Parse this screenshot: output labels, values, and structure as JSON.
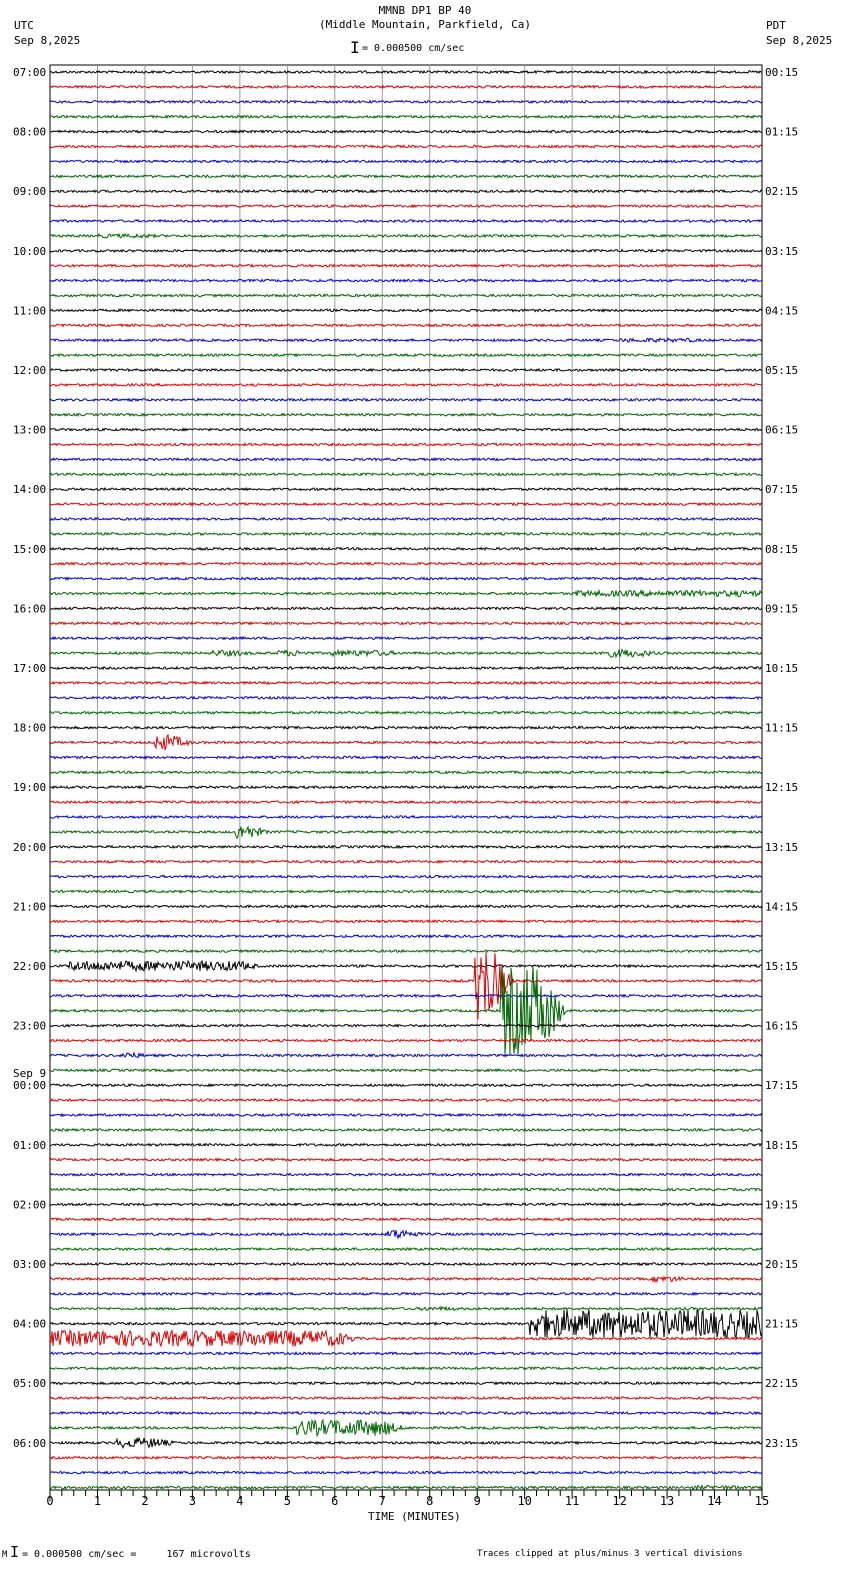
{
  "header": {
    "title": "MMNB DP1 BP 40",
    "subtitle": "(Middle Mountain, Parkfield, Ca)",
    "left_tz": "UTC",
    "left_date": "Sep 8,2025",
    "right_tz": "PDT",
    "right_date": "Sep 8,2025",
    "scale": "= 0.000500 cm/sec"
  },
  "footer": {
    "scale": "= 0.000500 cm/sec =     167 microvolts",
    "clip_note": "Traces clipped at plus/minus 3 vertical divisions",
    "mark": "M"
  },
  "chart_data": {
    "type": "line",
    "title": "MMNB DP1 BP 40",
    "xlabel": "TIME (MINUTES)",
    "xlim": [
      0,
      15
    ],
    "x_ticks": [
      "0",
      "1",
      "2",
      "3",
      "4",
      "5",
      "6",
      "7",
      "8",
      "9",
      "10",
      "11",
      "12",
      "13",
      "14",
      "15"
    ],
    "traces_per_hour": 4,
    "trace_colors": [
      "#000000",
      "#dd0000",
      "#0000cc",
      "#006600"
    ],
    "left_labels": [
      "07:00",
      "08:00",
      "09:00",
      "10:00",
      "11:00",
      "12:00",
      "13:00",
      "14:00",
      "15:00",
      "16:00",
      "17:00",
      "18:00",
      "19:00",
      "20:00",
      "21:00",
      "22:00",
      "23:00",
      "00:00",
      "01:00",
      "02:00",
      "03:00",
      "04:00",
      "05:00",
      "06:00"
    ],
    "date_change": {
      "before": "00:00",
      "label": "Sep 9"
    },
    "right_labels": [
      "00:15",
      "01:15",
      "02:15",
      "03:15",
      "04:15",
      "05:15",
      "06:15",
      "07:15",
      "08:15",
      "09:15",
      "10:15",
      "11:15",
      "12:15",
      "13:15",
      "14:15",
      "15:15",
      "16:15",
      "17:15",
      "18:15",
      "19:15",
      "20:15",
      "21:15",
      "22:15",
      "23:15"
    ],
    "events": [
      {
        "trace": 11,
        "start": 1.0,
        "end": 2.0,
        "amp": 2
      },
      {
        "trace": 18,
        "start": 12.0,
        "end": 13.5,
        "amp": 2
      },
      {
        "trace": 35,
        "start": 11.0,
        "end": 15.0,
        "amp": 3
      },
      {
        "trace": 39,
        "start": 3.4,
        "end": 3.9,
        "amp": 3
      },
      {
        "trace": 39,
        "start": 4.8,
        "end": 5.2,
        "amp": 3
      },
      {
        "trace": 39,
        "start": 5.9,
        "end": 7.0,
        "amp": 3
      },
      {
        "trace": 39,
        "start": 11.6,
        "end": 12.4,
        "amp": 4
      },
      {
        "trace": 45,
        "start": 2.2,
        "end": 2.5,
        "amp": 8
      },
      {
        "trace": 51,
        "start": 3.9,
        "end": 4.1,
        "amp": 8
      },
      {
        "trace": 60,
        "start": 0.4,
        "end": 4.0,
        "amp": 5
      },
      {
        "trace": 61,
        "start": 8.95,
        "end": 9.2,
        "amp": 40
      },
      {
        "trace": 63,
        "start": 9.5,
        "end": 10.3,
        "amp": 45
      },
      {
        "trace": 66,
        "start": 1.5,
        "end": 1.6,
        "amp": 4
      },
      {
        "trace": 78,
        "start": 7.1,
        "end": 7.4,
        "amp": 5
      },
      {
        "trace": 81,
        "start": 12.7,
        "end": 13.1,
        "amp": 3
      },
      {
        "trace": 83,
        "start": 7.8,
        "end": 8.4,
        "amp": 2
      },
      {
        "trace": 84,
        "start": 10.1,
        "end": 15.0,
        "amp": 14
      },
      {
        "trace": 85,
        "start": 0.0,
        "end": 6.0,
        "amp": 8
      },
      {
        "trace": 91,
        "start": 5.2,
        "end": 7.0,
        "amp": 8
      },
      {
        "trace": 92,
        "start": 1.4,
        "end": 2.2,
        "amp": 5
      },
      {
        "trace": 95,
        "start": 13.5,
        "end": 14.5,
        "amp": 2
      }
    ]
  }
}
